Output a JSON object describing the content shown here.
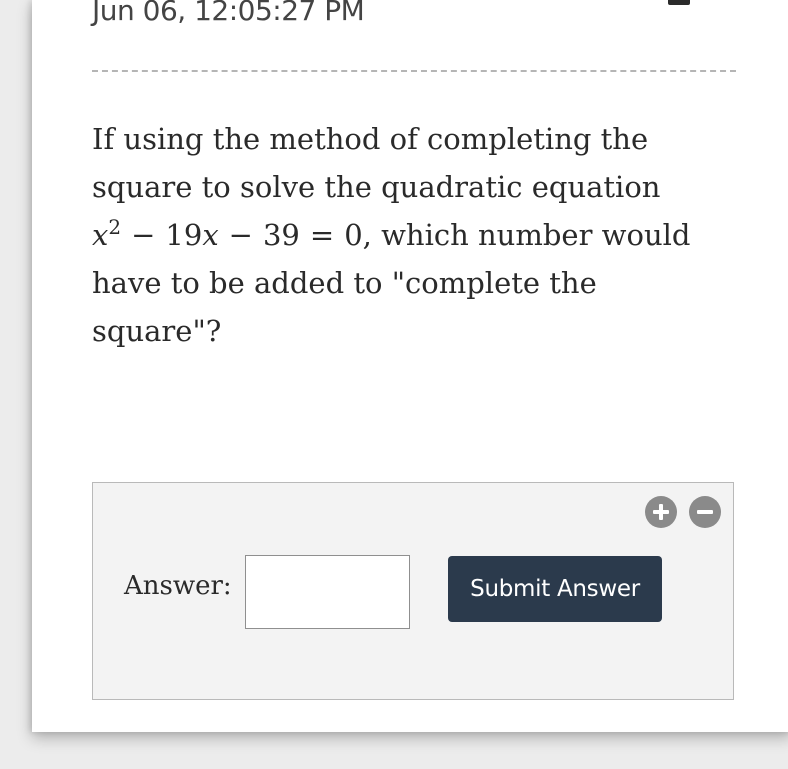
{
  "header": {
    "timestamp": "Jun 06, 12:05:27 PM"
  },
  "question": {
    "text_before": "If using the method of completing the square to solve the quadratic equation ",
    "equation": {
      "variable": "x",
      "exponent": "2",
      "minus_1": "−",
      "coef": "19",
      "variable_2": "x",
      "minus_2": "−",
      "constant": "39",
      "equals": "=",
      "rhs": "0"
    },
    "text_after": ", which number would have to be added to \"complete the square\"?"
  },
  "answer_panel": {
    "zoom_in_icon": "plus-circle-icon",
    "zoom_out_icon": "minus-circle-icon",
    "label": "Answer:",
    "input_value": "",
    "submit_label": "Submit Answer"
  },
  "colors": {
    "submit_bg": "#2b3a4c",
    "zoom_icon_bg": "#8a8a8a",
    "panel_bg": "#f3f3f3"
  }
}
